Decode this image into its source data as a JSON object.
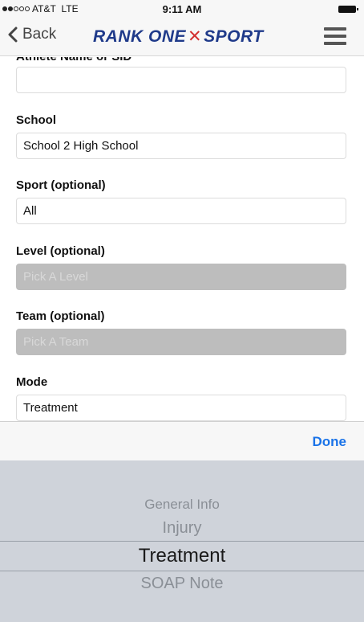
{
  "status_bar": {
    "carrier": "AT&T",
    "network": "LTE",
    "time": "9:11 AM"
  },
  "nav": {
    "back_label": "Back",
    "logo_left": "RANK ONE",
    "logo_right": "SPORT"
  },
  "form": {
    "cut_label": "Athlete Name or SID",
    "athlete_value": "",
    "school_label": "School",
    "school_value": "School 2 High School",
    "sport_label": "Sport (optional)",
    "sport_value": "All",
    "level_label": "Level (optional)",
    "level_placeholder": "Pick A Level",
    "team_label": "Team (optional)",
    "team_placeholder": "Pick A Team",
    "mode_label": "Mode",
    "mode_value": "Treatment"
  },
  "picker": {
    "done_label": "Done",
    "options": [
      "General Info",
      "Injury",
      "Treatment",
      "SOAP Note"
    ],
    "selected": "Treatment"
  },
  "colors": {
    "accent": "#1a73e8",
    "logo_blue": "#1f3a8a",
    "logo_red": "#d32f2f",
    "disabled_field": "#bdbdbd"
  }
}
